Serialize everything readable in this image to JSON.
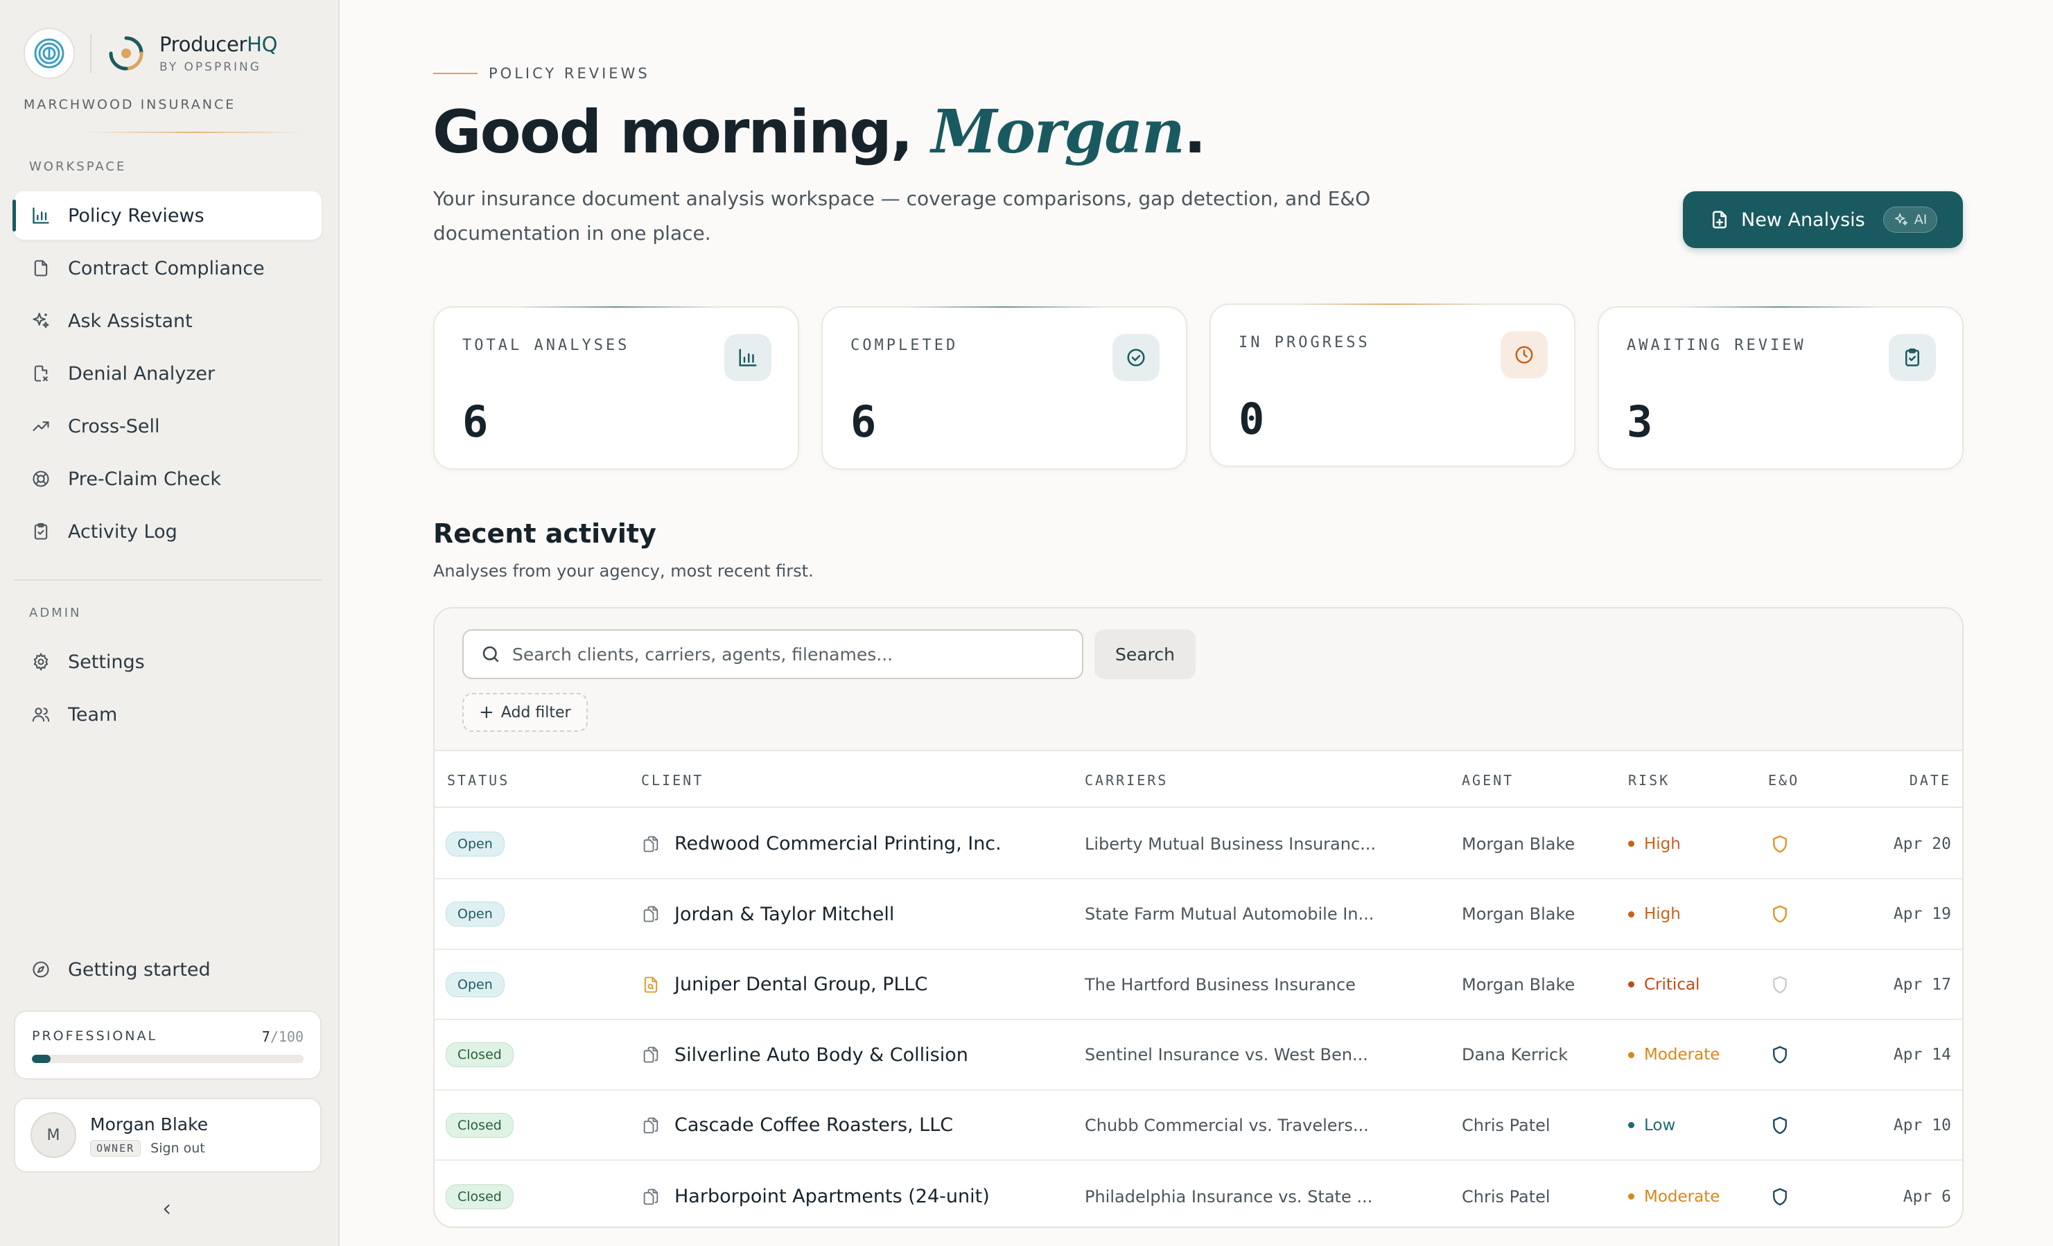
{
  "brand": {
    "name_main": "Producer",
    "name_accent": "HQ",
    "sub": "BY OPSPRING"
  },
  "org": "MARCHWOOD INSURANCE",
  "sidebar": {
    "workspace_label": "WORKSPACE",
    "admin_label": "ADMIN",
    "items": [
      {
        "label": "Policy Reviews",
        "icon": "bar-chart-icon",
        "active": true
      },
      {
        "label": "Contract Compliance",
        "icon": "document-icon"
      },
      {
        "label": "Ask Assistant",
        "icon": "sparkles-icon"
      },
      {
        "label": "Denial Analyzer",
        "icon": "document-x-icon"
      },
      {
        "label": "Cross-Sell",
        "icon": "trending-up-icon"
      },
      {
        "label": "Pre-Claim Check",
        "icon": "lifebuoy-icon"
      },
      {
        "label": "Activity Log",
        "icon": "clipboard-check-icon"
      }
    ],
    "admin_items": [
      {
        "label": "Settings",
        "icon": "gear-icon"
      },
      {
        "label": "Team",
        "icon": "users-icon"
      }
    ],
    "getting_started": "Getting started",
    "plan": {
      "name": "PROFESSIONAL",
      "used": "7",
      "total": "/100",
      "fraction": 0.07
    },
    "user": {
      "initial": "M",
      "name": "Morgan Blake",
      "role": "OWNER",
      "signout": "Sign out"
    }
  },
  "header": {
    "eyebrow": "POLICY REVIEWS",
    "greeting": "Good morning, ",
    "name": "Morgan",
    "period": ".",
    "intro": "Your insurance document analysis workspace — coverage comparisons, gap detection, and E&O documentation in one place.",
    "new_button": "New Analysis",
    "ai_label": "AI"
  },
  "stats": [
    {
      "label": "TOTAL ANALYSES",
      "value": "6",
      "icon": "bar-chart-icon"
    },
    {
      "label": "COMPLETED",
      "value": "6",
      "icon": "check-circle-icon"
    },
    {
      "label": "IN PROGRESS",
      "value": "0",
      "icon": "clock-icon"
    },
    {
      "label": "AWAITING REVIEW",
      "value": "3",
      "icon": "clipboard-check-icon"
    }
  ],
  "recent": {
    "title": "Recent activity",
    "subtitle": "Analyses from your agency, most recent first.",
    "search_placeholder": "Search clients, carriers, agents, filenames...",
    "search_button": "Search",
    "add_filter": "Add filter",
    "columns": [
      "STATUS",
      "CLIENT",
      "CARRIERS",
      "AGENT",
      "RISK",
      "E&O",
      "DATE"
    ],
    "rows": [
      {
        "status": "Open",
        "client": "Redwood Commercial Printing, Inc.",
        "file": "document-pair-icon",
        "carriers": "Liberty Mutual Business Insuranc...",
        "agent": "Morgan Blake",
        "risk": "High",
        "eo": "warning",
        "date": "Apr 20"
      },
      {
        "status": "Open",
        "client": "Jordan & Taylor Mitchell",
        "file": "document-pair-icon",
        "carriers": "State Farm Mutual Automobile In...",
        "agent": "Morgan Blake",
        "risk": "High",
        "eo": "warning",
        "date": "Apr 19"
      },
      {
        "status": "Open",
        "client": "Juniper Dental Group, PLLC",
        "file": "document-search-icon",
        "carriers": "The Hartford Business Insurance",
        "agent": "Morgan Blake",
        "risk": "Critical",
        "eo": "none",
        "date": "Apr 17"
      },
      {
        "status": "Closed",
        "client": "Silverline Auto Body & Collision",
        "file": "document-pair-icon",
        "carriers": "Sentinel Insurance vs. West Ben...",
        "agent": "Dana Kerrick",
        "risk": "Moderate",
        "eo": "documented",
        "date": "Apr 14"
      },
      {
        "status": "Closed",
        "client": "Cascade Coffee Roasters, LLC",
        "file": "document-pair-icon",
        "carriers": "Chubb Commercial vs. Travelers...",
        "agent": "Chris Patel",
        "risk": "Low",
        "eo": "documented",
        "date": "Apr 10"
      },
      {
        "status": "Closed",
        "client": "Harborpoint Apartments (24-unit)",
        "file": "document-pair-icon",
        "carriers": "Philadelphia Insurance vs. State ...",
        "agent": "Chris Patel",
        "risk": "Moderate",
        "eo": "documented",
        "date": "Apr 6"
      }
    ]
  },
  "colors": {
    "accent": "#195a60",
    "warm": "#dba45f",
    "risk_high": "#c8601a",
    "risk_critical": "#c24a14",
    "risk_moderate": "#d7871e",
    "risk_low": "#1e6a70",
    "eo_warning": "#e0962a",
    "eo_documented": "#1f4a5c",
    "eo_none": "#c9cdd0"
  }
}
